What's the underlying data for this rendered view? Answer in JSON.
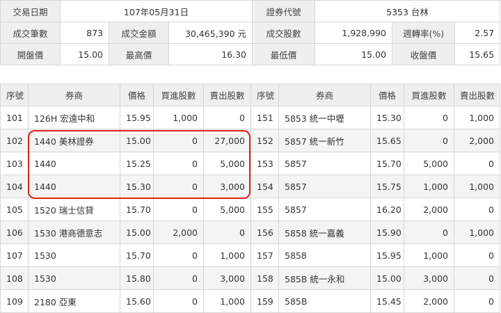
{
  "summary": {
    "row1": {
      "trade_date_label": "交易日期",
      "trade_date_value": "107年05月31日",
      "security_code_label": "證券代號",
      "security_code_value": "5353 台林"
    },
    "row2": {
      "trade_count_label": "成交筆數",
      "trade_count_value": "873",
      "trade_amount_label": "成交金額",
      "trade_amount_value": "30,465,390 元",
      "trade_shares_label": "成交股數",
      "trade_shares_value": "1,928,990",
      "turnover_label": "週轉率(%)",
      "turnover_value": "2.57"
    },
    "row3": {
      "open_label": "開盤價",
      "open_value": "15.00",
      "high_label": "最高價",
      "high_value": "16.30",
      "low_label": "最低價",
      "low_value": "15.00",
      "close_label": "收盤價",
      "close_value": "15.65"
    }
  },
  "trades": {
    "headers": [
      "序號",
      "券商",
      "價格",
      "買進股數",
      "賣出股數",
      "序號",
      "券商",
      "價格",
      "買進股數",
      "賣出股數"
    ],
    "rows": [
      [
        [
          "101",
          "126H 宏遠中和",
          "15.95",
          "1,000",
          "0"
        ],
        [
          "151",
          "5853 統一中壢",
          "15.30",
          "0",
          "1,000"
        ]
      ],
      [
        [
          "102",
          "1440 美林證券",
          "15.00",
          "0",
          "27,000"
        ],
        [
          "152",
          "5857 統一新竹",
          "15.65",
          "0",
          "2,000"
        ]
      ],
      [
        [
          "103",
          "1440",
          "15.25",
          "0",
          "5,000"
        ],
        [
          "153",
          "5857",
          "15.70",
          "5,000",
          "0"
        ]
      ],
      [
        [
          "104",
          "1440",
          "15.30",
          "0",
          "3,000"
        ],
        [
          "154",
          "5857",
          "15.75",
          "1,000",
          "1,000"
        ]
      ],
      [
        [
          "105",
          "1520 瑞士信貸",
          "15.70",
          "0",
          "5,000"
        ],
        [
          "155",
          "5857",
          "16.20",
          "2,000",
          "0"
        ]
      ],
      [
        [
          "106",
          "1530 港商德意志",
          "15.00",
          "2,000",
          "0"
        ],
        [
          "156",
          "5858 統一嘉義",
          "15.90",
          "0",
          "1,000"
        ]
      ],
      [
        [
          "107",
          "1530",
          "15.70",
          "0",
          "1,000"
        ],
        [
          "157",
          "5858",
          "15.95",
          "1,000",
          "0"
        ]
      ],
      [
        [
          "108",
          "1530",
          "15.80",
          "0",
          "3,000"
        ],
        [
          "158",
          "585B 統一永和",
          "15.00",
          "3,000",
          "0"
        ]
      ],
      [
        [
          "109",
          "2180 亞東",
          "15.60",
          "0",
          "1,000"
        ],
        [
          "159",
          "585B",
          "15.45",
          "2,000",
          "0"
        ]
      ]
    ]
  },
  "highlight_color": "#e0201b"
}
